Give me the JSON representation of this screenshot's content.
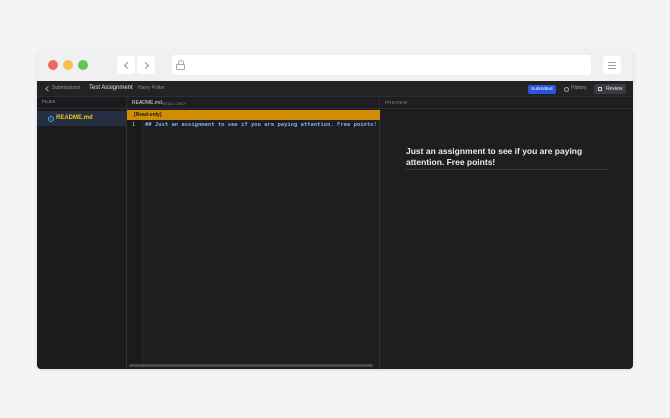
{
  "browser": {
    "traffic_lights": {
      "close": "#ee6a5f",
      "minimize": "#f5be4f",
      "zoom": "#62c655"
    },
    "back_icon": "chevron-left-icon",
    "forward_icon": "chevron-right-icon",
    "url_icon": "lock-icon",
    "menu_icon": "hamburger-menu-icon"
  },
  "header": {
    "breadcrumb_back": "Submissions",
    "assignment_title": "Test Assignment",
    "student_name": "Harry Potter",
    "status_badge": "Submitted",
    "status_color": "#2a55d8",
    "history_label": "History",
    "review_label": "Review"
  },
  "sidebar": {
    "heading": "FILES",
    "items": [
      {
        "label": "README.md",
        "icon": "info-icon",
        "color": "#f2c318"
      }
    ]
  },
  "editor": {
    "file_name": "README.md",
    "mode_label": "READ-ONLY",
    "banner": "[Read-only]",
    "banner_color": "#d18d05",
    "lines": [
      {
        "number": "1",
        "text": "## Just an assignment to see if you are paying attention. Free points!"
      }
    ]
  },
  "preview": {
    "heading": "PREVIEW",
    "rendered_heading": "Just an assignment to see if you are paying attention. Free points!"
  }
}
